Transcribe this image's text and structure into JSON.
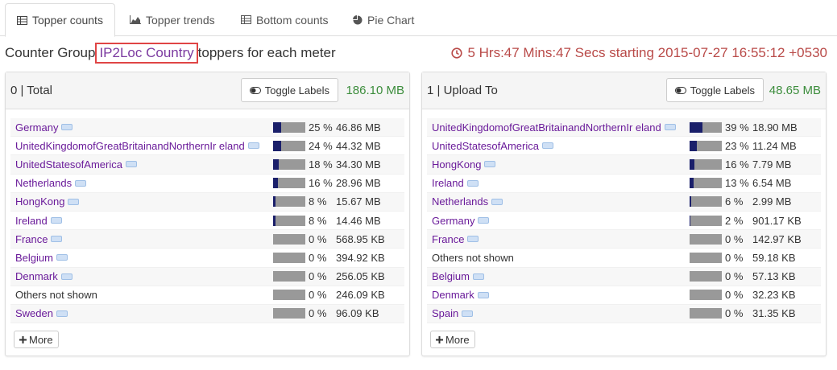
{
  "tabs": [
    {
      "label": "Topper counts",
      "icon": "table-icon",
      "active": true
    },
    {
      "label": "Topper trends",
      "icon": "area-chart-icon",
      "active": false
    },
    {
      "label": "Bottom counts",
      "icon": "table-icon",
      "active": false
    },
    {
      "label": "Pie Chart",
      "icon": "pie-chart-icon",
      "active": false
    }
  ],
  "heading": {
    "prefix": "Counter Group",
    "group_name": "IP2Loc Country",
    "suffix": "toppers for each meter"
  },
  "timer": {
    "text": "5 Hrs:47 Mins:47 Secs starting 2015-07-27 16:55:12 +0530",
    "color": "#b94a48"
  },
  "panels": [
    {
      "title": "0 | Total",
      "toggle_label": "Toggle Labels",
      "total": "186.10 MB",
      "more_label": "More",
      "rows": [
        {
          "name": "Germany",
          "link": true,
          "pct": "25 %",
          "fill": 0.25,
          "size": "46.86 MB"
        },
        {
          "name": "UnitedKingdomofGreatBritainandNorthernIr eland",
          "link": true,
          "pct": "24 %",
          "fill": 0.24,
          "size": "44.32 MB"
        },
        {
          "name": "UnitedStatesofAmerica",
          "link": true,
          "pct": "18 %",
          "fill": 0.18,
          "size": "34.30 MB"
        },
        {
          "name": "Netherlands",
          "link": true,
          "pct": "16 %",
          "fill": 0.16,
          "size": "28.96 MB"
        },
        {
          "name": "HongKong",
          "link": true,
          "pct": "8 %",
          "fill": 0.08,
          "size": "15.67 MB"
        },
        {
          "name": "Ireland",
          "link": true,
          "pct": "8 %",
          "fill": 0.08,
          "size": "14.46 MB"
        },
        {
          "name": "France",
          "link": true,
          "pct": "0 %",
          "fill": 0.0,
          "size": "568.95 KB"
        },
        {
          "name": "Belgium",
          "link": true,
          "pct": "0 %",
          "fill": 0.0,
          "size": "394.92 KB"
        },
        {
          "name": "Denmark",
          "link": true,
          "pct": "0 %",
          "fill": 0.0,
          "size": "256.05 KB"
        },
        {
          "name": "Others not shown",
          "link": false,
          "pct": "0 %",
          "fill": 0.0,
          "size": "246.09 KB"
        },
        {
          "name": "Sweden",
          "link": true,
          "pct": "0 %",
          "fill": 0.0,
          "size": "96.09 KB"
        }
      ]
    },
    {
      "title": "1 | Upload To",
      "toggle_label": "Toggle Labels",
      "total": "48.65 MB",
      "more_label": "More",
      "rows": [
        {
          "name": "UnitedKingdomofGreatBritainandNorthernIr eland",
          "link": true,
          "pct": "39 %",
          "fill": 0.39,
          "size": "18.90 MB"
        },
        {
          "name": "UnitedStatesofAmerica",
          "link": true,
          "pct": "23 %",
          "fill": 0.23,
          "size": "11.24 MB"
        },
        {
          "name": "HongKong",
          "link": true,
          "pct": "16 %",
          "fill": 0.16,
          "size": "7.79 MB"
        },
        {
          "name": "Ireland",
          "link": true,
          "pct": "13 %",
          "fill": 0.13,
          "size": "6.54 MB"
        },
        {
          "name": "Netherlands",
          "link": true,
          "pct": "6 %",
          "fill": 0.06,
          "size": "2.99 MB"
        },
        {
          "name": "Germany",
          "link": true,
          "pct": "2 %",
          "fill": 0.02,
          "size": "901.17 KB"
        },
        {
          "name": "France",
          "link": true,
          "pct": "0 %",
          "fill": 0.0,
          "size": "142.97 KB"
        },
        {
          "name": "Others not shown",
          "link": false,
          "pct": "0 %",
          "fill": 0.0,
          "size": "59.18 KB"
        },
        {
          "name": "Belgium",
          "link": true,
          "pct": "0 %",
          "fill": 0.0,
          "size": "57.13 KB"
        },
        {
          "name": "Denmark",
          "link": true,
          "pct": "0 %",
          "fill": 0.0,
          "size": "32.23 KB"
        },
        {
          "name": "Spain",
          "link": true,
          "pct": "0 %",
          "fill": 0.0,
          "size": "31.35 KB"
        }
      ]
    }
  ],
  "colors": {
    "link": "#6a1b9a",
    "total": "#3c8d3c",
    "bar_fill": "#1a1f6a",
    "bar_bg": "#999999",
    "highlight_box": "#e04545"
  }
}
